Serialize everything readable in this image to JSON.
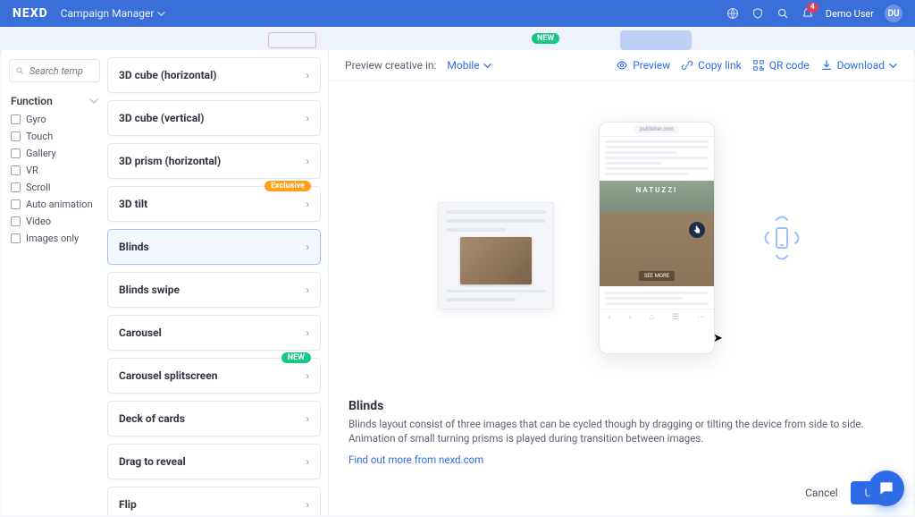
{
  "topnav": {
    "logo": "NEXD",
    "section": "Campaign Manager",
    "notification_count": "4",
    "user_name": "Demo User",
    "user_initials": "DU"
  },
  "secondbar": {
    "new_badge": "NEW"
  },
  "search": {
    "placeholder": "Search temp"
  },
  "filter": {
    "title": "Function",
    "items": [
      {
        "label": "Gyro"
      },
      {
        "label": "Touch"
      },
      {
        "label": "Gallery"
      },
      {
        "label": "VR"
      },
      {
        "label": "Scroll"
      },
      {
        "label": "Auto animation"
      },
      {
        "label": "Video"
      },
      {
        "label": "Images only"
      }
    ]
  },
  "templates": [
    {
      "label": "3D cube (horizontal)"
    },
    {
      "label": "3D cube (vertical)"
    },
    {
      "label": "3D prism (horizontal)"
    },
    {
      "label": "3D tilt",
      "badge": "Exclusive",
      "badge_kind": "excl"
    },
    {
      "label": "Blinds",
      "selected": true
    },
    {
      "label": "Blinds swipe"
    },
    {
      "label": "Carousel"
    },
    {
      "label": "Carousel splitscreen",
      "badge": "NEW",
      "badge_kind": "new"
    },
    {
      "label": "Deck of cards"
    },
    {
      "label": "Drag to reveal"
    },
    {
      "label": "Flip"
    }
  ],
  "preview": {
    "label": "Preview creative in:",
    "mode": "Mobile",
    "actions": {
      "preview": "Preview",
      "copy": "Copy link",
      "qr": "QR code",
      "download": "Download"
    },
    "phone_url": "publisher.com",
    "ad_brand": "NATUZZI",
    "ad_cta": "SEE MORE"
  },
  "detail": {
    "title": "Blinds",
    "body": "Blinds layout consist of three images that can be cycled though by dragging or tilting the device from side to side. Animation of small turning prisms is played during transition between images.",
    "link": "Find out more from nexd.com"
  },
  "footer": {
    "cancel": "Cancel",
    "use": "Use"
  }
}
